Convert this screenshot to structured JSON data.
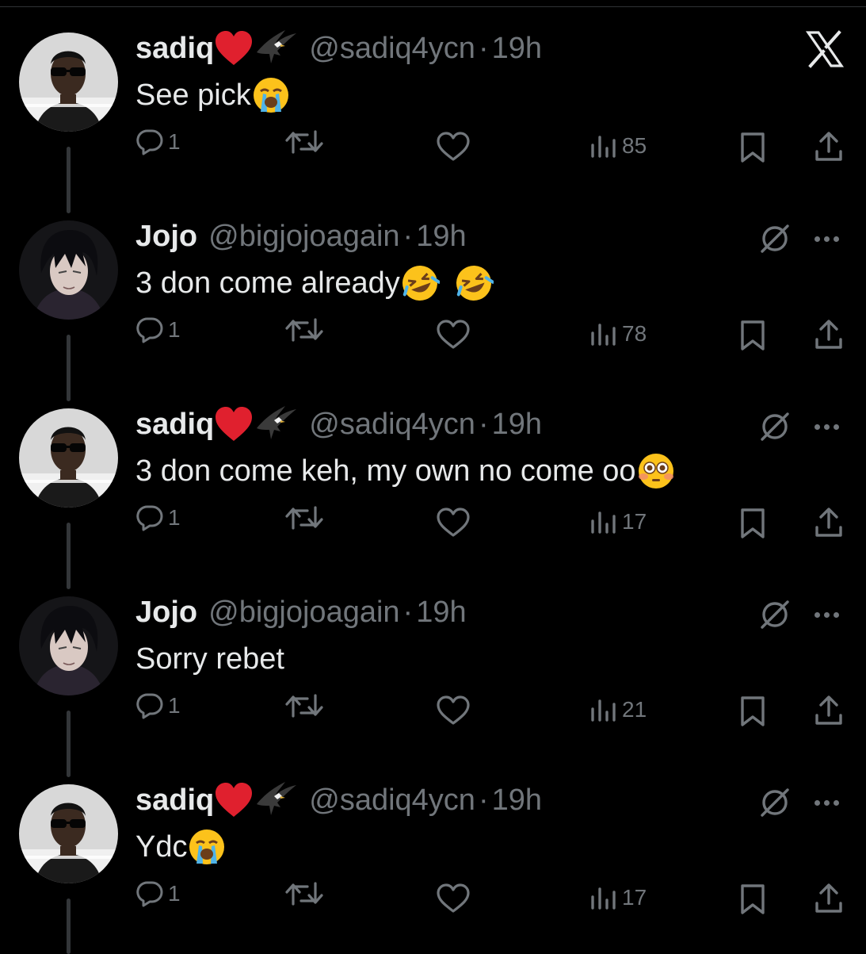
{
  "tweets": [
    {
      "name": "sadiq",
      "handle": "@sadiq4ycn",
      "dot": "·",
      "time": "19h",
      "text": "See pick",
      "text_emoji": "loudly-crying-face",
      "replies": "1",
      "views": "85",
      "author": "sadiq"
    },
    {
      "name": "Jojo",
      "handle": "@bigjojoagain",
      "dot": "·",
      "time": "19h",
      "text": "3 don come already",
      "text_emoji": "rolling-on-floor-laughing-x2",
      "replies": "1",
      "views": "78",
      "author": "jojo"
    },
    {
      "name": "sadiq",
      "handle": "@sadiq4ycn",
      "dot": "·",
      "time": "19h",
      "text": "3 don come keh, my own no come oo",
      "text_emoji": "flushed-face",
      "replies": "1",
      "views": "17",
      "author": "sadiq"
    },
    {
      "name": "Jojo",
      "handle": "@bigjojoagain",
      "dot": "·",
      "time": "19h",
      "text": "Sorry rebet",
      "text_emoji": "",
      "replies": "1",
      "views": "21",
      "author": "jojo"
    },
    {
      "name": "sadiq",
      "handle": "@sadiq4ycn",
      "dot": "·",
      "time": "19h",
      "text": "Ydc",
      "text_emoji": "loudly-crying-face",
      "replies": "1",
      "views": "17",
      "author": "sadiq"
    }
  ],
  "colors": {
    "background": "#000000",
    "text": "#e7e9ea",
    "muted": "#71767b",
    "heart": "#e0202e"
  }
}
